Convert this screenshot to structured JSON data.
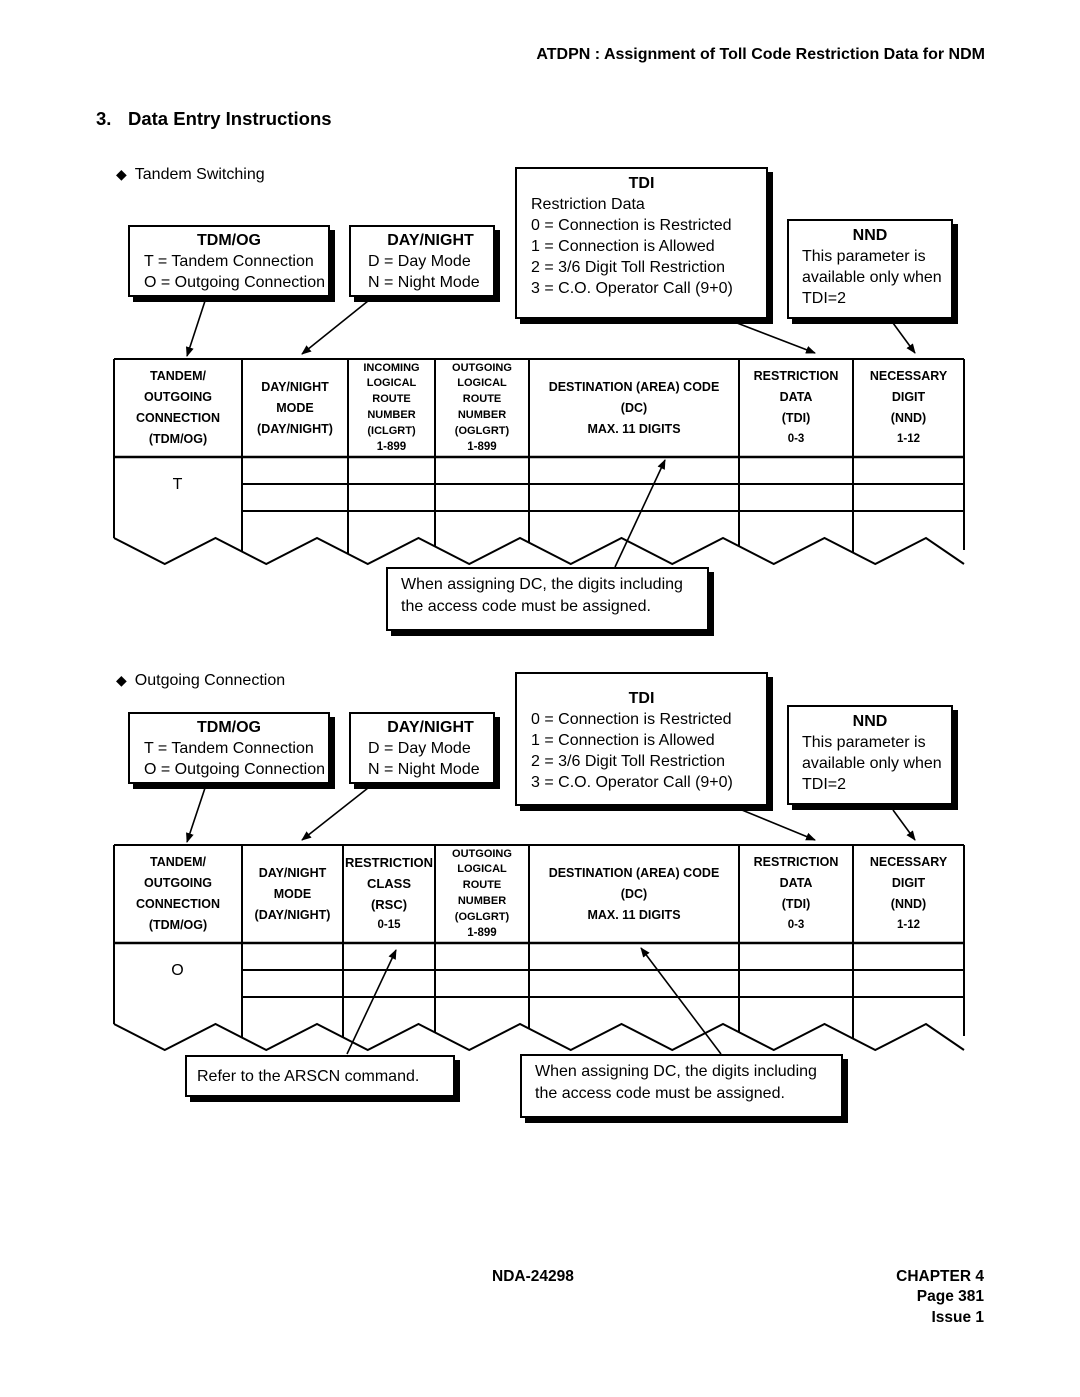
{
  "header": {
    "title": "ATDPN : Assignment of Toll Code Restriction Data for NDM"
  },
  "section": {
    "number": "3.",
    "title": "Data Entry Instructions"
  },
  "tandem": {
    "bullet": "Tandem Switching",
    "tdmog_box": {
      "title": "TDM/OG",
      "lines": [
        "T = Tandem Connection",
        "O = Outgoing Connection"
      ]
    },
    "daynight_box": {
      "title": "DAY/NIGHT",
      "lines": [
        "D = Day Mode",
        "N = Night Mode"
      ]
    },
    "tdi_box": {
      "title": "TDI",
      "lines": [
        "Restriction Data",
        "0 = Connection is Restricted",
        "1 = Connection is Allowed",
        "2 = 3/6 Digit Toll Restriction",
        "3 = C.O. Operator Call (9+0)"
      ]
    },
    "nnd_box": {
      "title": "NND",
      "lines": [
        "This parameter is",
        "available only when",
        "TDI=2"
      ]
    },
    "table": {
      "columns": [
        {
          "lines": [
            "TANDEM/",
            "OUTGOING",
            "CONNECTION",
            "(TDM/OG)"
          ]
        },
        {
          "lines": [
            "DAY/NIGHT",
            "MODE",
            "(DAY/NIGHT)"
          ]
        },
        {
          "lines": [
            "INCOMING",
            "LOGICAL",
            "ROUTE",
            "NUMBER",
            "(ICLGRT)",
            "1-899"
          ]
        },
        {
          "lines": [
            "OUTGOING",
            "LOGICAL",
            "ROUTE",
            "NUMBER",
            "(OGLGRT)",
            "1-899"
          ]
        },
        {
          "lines": [
            "DESTINATION (AREA) CODE",
            "(DC)",
            "MAX. 11 DIGITS"
          ]
        },
        {
          "lines": [
            "RESTRICTION",
            "DATA",
            "(TDI)",
            "0-3"
          ]
        },
        {
          "lines": [
            "NECESSARY",
            "DIGIT",
            "(NND)",
            "1-12"
          ]
        }
      ],
      "first_cell_value": "T"
    },
    "dc_note": {
      "lines": [
        "When assigning DC, the digits including",
        "the access code must be assigned."
      ]
    }
  },
  "outgoing": {
    "bullet": "Outgoing Connection",
    "tdmog_box": {
      "title": "TDM/OG",
      "lines": [
        "T = Tandem Connection",
        "O = Outgoing Connection"
      ]
    },
    "daynight_box": {
      "title": "DAY/NIGHT",
      "lines": [
        "D = Day Mode",
        "N = Night Mode"
      ]
    },
    "tdi_box": {
      "title": "TDI",
      "lines": [
        "0 = Connection is Restricted",
        "1 = Connection is Allowed",
        "2 = 3/6 Digit Toll Restriction",
        "3 = C.O. Operator Call (9+0)"
      ]
    },
    "nnd_box": {
      "title": "NND",
      "lines": [
        "This parameter is",
        "available only when",
        "TDI=2"
      ]
    },
    "table": {
      "columns": [
        {
          "lines": [
            "TANDEM/",
            "OUTGOING",
            "CONNECTION",
            "(TDM/OG)"
          ]
        },
        {
          "lines": [
            "DAY/NIGHT",
            "MODE",
            "(DAY/NIGHT)"
          ]
        },
        {
          "lines": [
            "RESTRICTION",
            "CLASS",
            "(RSC)",
            "0-15"
          ]
        },
        {
          "lines": [
            "OUTGOING",
            "LOGICAL",
            "ROUTE",
            "NUMBER",
            "(OGLGRT)",
            "1-899"
          ]
        },
        {
          "lines": [
            "DESTINATION (AREA) CODE",
            "(DC)",
            "MAX. 11 DIGITS"
          ]
        },
        {
          "lines": [
            "RESTRICTION",
            "DATA",
            "(TDI)",
            "0-3"
          ]
        },
        {
          "lines": [
            "NECESSARY",
            "DIGIT",
            "(NND)",
            "1-12"
          ]
        }
      ],
      "first_cell_value": "O"
    },
    "rsc_note": {
      "lines": [
        "Refer to the ARSCN command."
      ]
    },
    "dc_note": {
      "lines": [
        "When assigning DC, the digits including",
        "the access code must be assigned."
      ]
    }
  },
  "footer": {
    "doc_number": "NDA-24298",
    "chapter": "CHAPTER 4",
    "page": "Page 381",
    "issue": "Issue 1"
  }
}
